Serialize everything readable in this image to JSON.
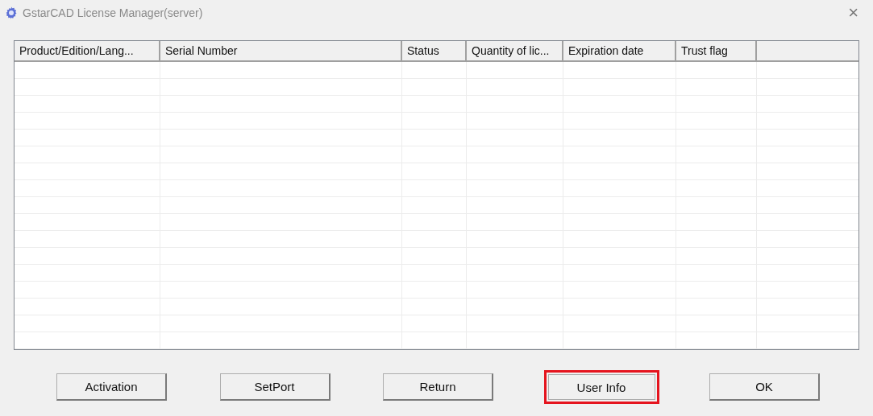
{
  "window": {
    "title": "GstarCAD License Manager(server)",
    "close": "×"
  },
  "table": {
    "columns": [
      {
        "label": "Product/Edition/Lang..."
      },
      {
        "label": "Serial Number"
      },
      {
        "label": "Status"
      },
      {
        "label": "Quantity of lic..."
      },
      {
        "label": "Expiration date"
      },
      {
        "label": "Trust flag"
      }
    ]
  },
  "buttons": [
    {
      "label": "Activation",
      "highlighted": false
    },
    {
      "label": "SetPort",
      "highlighted": false
    },
    {
      "label": "Return",
      "highlighted": false
    },
    {
      "label": "User Info",
      "highlighted": true
    },
    {
      "label": "OK",
      "highlighted": false
    }
  ]
}
